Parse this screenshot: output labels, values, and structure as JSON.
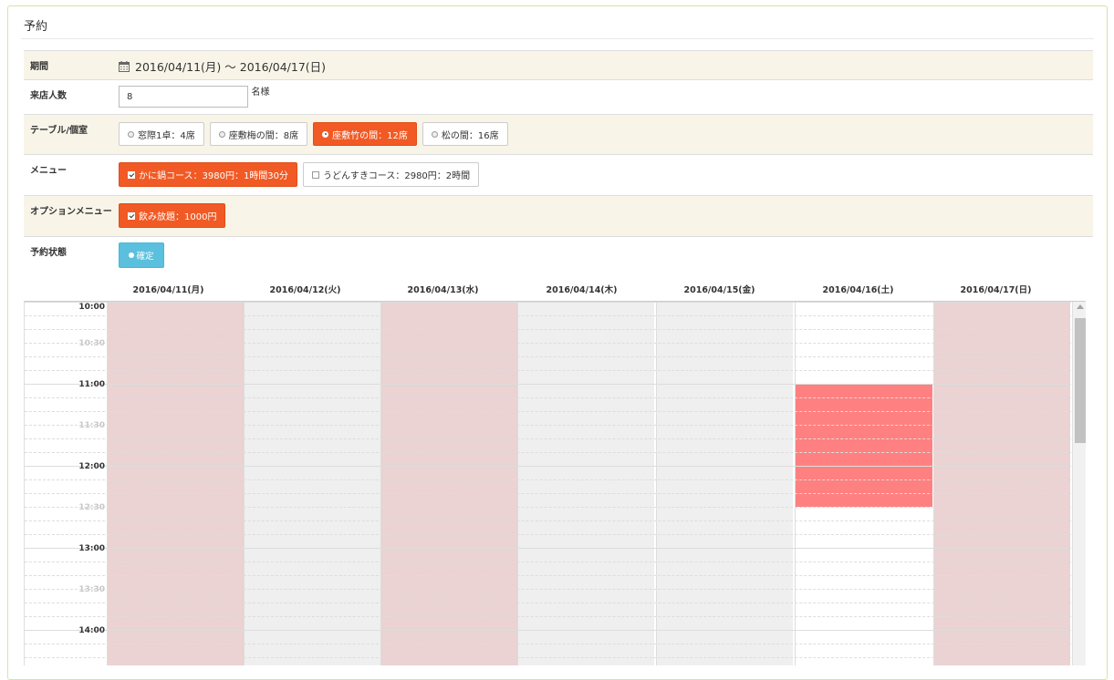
{
  "panel": {
    "title": "予約"
  },
  "form": {
    "period": {
      "label": "期間",
      "value": "2016/04/11(月) 〜 2016/04/17(日)",
      "icon": "calendar-icon"
    },
    "party_size": {
      "label": "来店人数",
      "value": "8",
      "suffix": "名様"
    },
    "table": {
      "label": "テーブル/個室",
      "options": [
        {
          "label": "窓際1卓：4席",
          "selected": false
        },
        {
          "label": "座敷梅の間：8席",
          "selected": false
        },
        {
          "label": "座敷竹の間：12席",
          "selected": true
        },
        {
          "label": "松の間：16席",
          "selected": false
        }
      ]
    },
    "menu": {
      "label": "メニュー",
      "options": [
        {
          "label": "かに鍋コース：3980円：1時間30分",
          "checked": true
        },
        {
          "label": "うどんすきコース：2980円：2時間",
          "checked": false
        }
      ]
    },
    "option_menu": {
      "label": "オプションメニュー",
      "options": [
        {
          "label": "飲み放題：1000円",
          "checked": true
        }
      ]
    },
    "status": {
      "label": "予約状態",
      "button": "確定"
    }
  },
  "calendar": {
    "days": [
      {
        "label": "2016/04/11(月)",
        "state": "unavailable"
      },
      {
        "label": "2016/04/12(火)",
        "state": "closed"
      },
      {
        "label": "2016/04/13(水)",
        "state": "unavailable"
      },
      {
        "label": "2016/04/14(木)",
        "state": "closed"
      },
      {
        "label": "2016/04/15(金)",
        "state": "closed"
      },
      {
        "label": "2016/04/16(土)",
        "state": "open"
      },
      {
        "label": "2016/04/17(日)",
        "state": "unavailable"
      }
    ],
    "times": [
      "10:00",
      "10:30",
      "11:00",
      "11:30",
      "12:00",
      "12:30",
      "13:00",
      "13:30",
      "14:00"
    ],
    "booking": {
      "day_index": 5,
      "start": "11:00",
      "end": "12:30"
    },
    "colors": {
      "unavailable": "#ebd2d3",
      "closed": "#efefef",
      "open": "#ffffff",
      "booking": "#ff8080",
      "accent": "#f15a24",
      "status": "#5bc0de"
    }
  }
}
